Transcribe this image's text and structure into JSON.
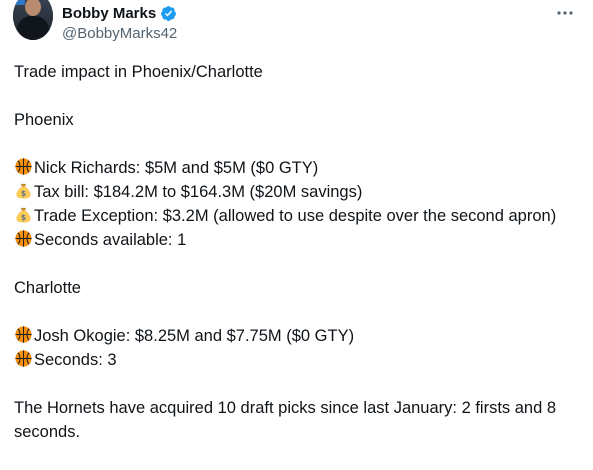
{
  "author": {
    "display_name": "Bobby Marks",
    "handle": "@BobbyMarks42",
    "verified": true,
    "verified_color": "#1d9bf0"
  },
  "more_icon": "more-horizontal-icon",
  "tweet": {
    "intro": "Trade impact in Phoenix/Charlotte",
    "phoenix": {
      "heading": "Phoenix",
      "lines": [
        {
          "icon": "basketball-icon",
          "text": "Nick Richards: $5M and $5M ($0 GTY)"
        },
        {
          "icon": "money-bag-icon",
          "text": "Tax bill: $184.2M to $164.3M ($20M savings)"
        },
        {
          "icon": "money-bag-icon",
          "text": "Trade Exception: $3.2M (allowed to use despite over the second apron)"
        },
        {
          "icon": "basketball-icon",
          "text": "Seconds available: 1"
        }
      ]
    },
    "charlotte": {
      "heading": "Charlotte",
      "lines": [
        {
          "icon": "basketball-icon",
          "text": "Josh Okogie: $8.25M and $7.75M ($0 GTY)"
        },
        {
          "icon": "basketball-icon",
          "text": "Seconds: 3"
        }
      ]
    },
    "closing": "The Hornets have acquired 10 draft picks since last January: 2 firsts and 8 seconds."
  }
}
